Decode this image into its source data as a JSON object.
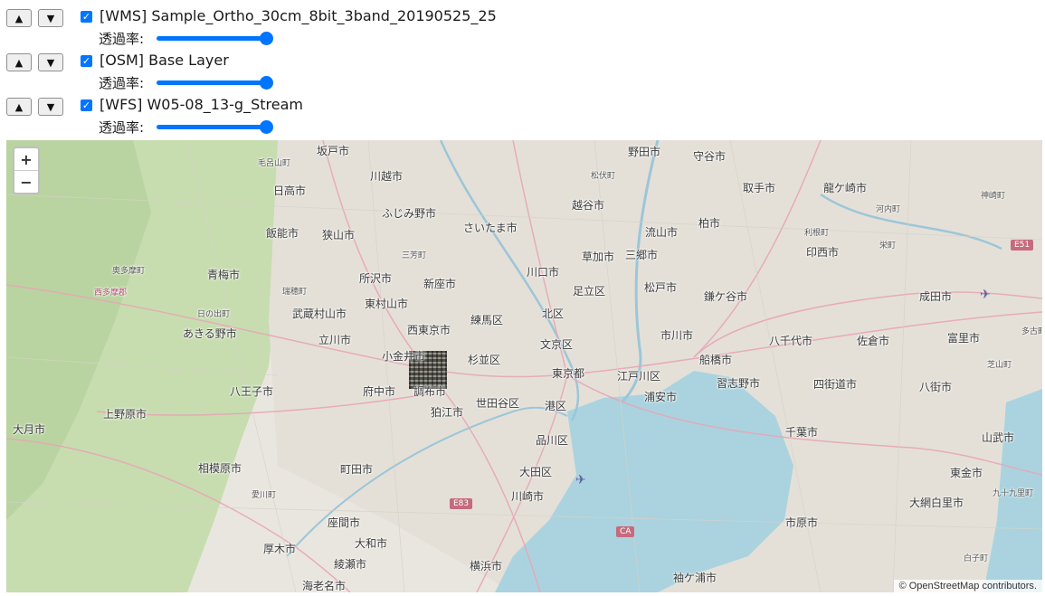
{
  "layers": [
    {
      "name": "[WMS] Sample_Ortho_30cm_8bit_3band_20190525_25",
      "opacity_label": "透過率:",
      "opacity": 1.0,
      "visible": true
    },
    {
      "name": "[OSM] Base Layer",
      "opacity_label": "透過率:",
      "opacity": 1.0,
      "visible": true
    },
    {
      "name": "[WFS] W05-08_13-g_Stream",
      "opacity_label": "透過率:",
      "opacity": 1.0,
      "visible": true
    }
  ],
  "controls": {
    "up": "▲",
    "down": "▼",
    "check": "✓"
  },
  "map": {
    "zoom_in": "+",
    "zoom_out": "−",
    "attribution": "© OpenStreetMap contributors.",
    "colors": {
      "land": "#e9e6df",
      "green": "#c7ddb0",
      "water": "#aad3df",
      "urban": "#e4e0d8"
    },
    "places": [
      {
        "t": "坂戸市"
      },
      {
        "t": "毛呂山町"
      },
      {
        "t": "川越市"
      },
      {
        "t": "野田市"
      },
      {
        "t": "守谷市"
      },
      {
        "t": "松伏町"
      },
      {
        "t": "日高市"
      },
      {
        "t": "取手市"
      },
      {
        "t": "龍ケ崎市"
      },
      {
        "t": "利根町"
      },
      {
        "t": "越谷市"
      },
      {
        "t": "ふじみ野市"
      },
      {
        "t": "さいたま市"
      },
      {
        "t": "流山市"
      },
      {
        "t": "柏市"
      },
      {
        "t": "飯能市"
      },
      {
        "t": "狭山市"
      },
      {
        "t": "三芳町"
      },
      {
        "t": "草加市"
      },
      {
        "t": "三郷市"
      },
      {
        "t": "印西市"
      },
      {
        "t": "栄町"
      },
      {
        "t": "河内町"
      },
      {
        "t": "神崎町"
      },
      {
        "t": "奥多摩町"
      },
      {
        "t": "青梅市"
      },
      {
        "t": "所沢市"
      },
      {
        "t": "川口市"
      },
      {
        "t": "西多摩郡"
      },
      {
        "t": "瑞穂町"
      },
      {
        "t": "新座市"
      },
      {
        "t": "足立区"
      },
      {
        "t": "松戸市"
      },
      {
        "t": "鎌ケ谷市"
      },
      {
        "t": "成田市"
      },
      {
        "t": "東村山市"
      },
      {
        "t": "日の出町"
      },
      {
        "t": "武蔵村山市"
      },
      {
        "t": "北区"
      },
      {
        "t": "練馬区"
      },
      {
        "t": "西東京市"
      },
      {
        "t": "あきる野市"
      },
      {
        "t": "立川市"
      },
      {
        "t": "文京区"
      },
      {
        "t": "市川市"
      },
      {
        "t": "八千代市"
      },
      {
        "t": "佐倉市"
      },
      {
        "t": "富里市"
      },
      {
        "t": "多古町"
      },
      {
        "t": "小金井市"
      },
      {
        "t": "杉並区"
      },
      {
        "t": "船橋市"
      },
      {
        "t": "芝山町"
      },
      {
        "t": "東京都"
      },
      {
        "t": "江戸川区"
      },
      {
        "t": "習志野市"
      },
      {
        "t": "四街道市"
      },
      {
        "t": "八街市"
      },
      {
        "t": "八王子市"
      },
      {
        "t": "府中市"
      },
      {
        "t": "調布市"
      },
      {
        "t": "世田谷区"
      },
      {
        "t": "港区"
      },
      {
        "t": "浦安市"
      },
      {
        "t": "上野原市"
      },
      {
        "t": "狛江市"
      },
      {
        "t": "千葉市"
      },
      {
        "t": "山武市"
      },
      {
        "t": "大月市"
      },
      {
        "t": "品川区"
      },
      {
        "t": "相模原市"
      },
      {
        "t": "町田市"
      },
      {
        "t": "大田区"
      },
      {
        "t": "東金市"
      },
      {
        "t": "愛川町"
      },
      {
        "t": "川崎市"
      },
      {
        "t": "九十九里町"
      },
      {
        "t": "大網白里市"
      },
      {
        "t": "座間市"
      },
      {
        "t": "市原市"
      },
      {
        "t": "厚木市"
      },
      {
        "t": "大和市"
      },
      {
        "t": "白子町"
      },
      {
        "t": "綾瀬市"
      },
      {
        "t": "横浜市"
      },
      {
        "t": "袖ケ浦市"
      },
      {
        "t": "海老名市"
      }
    ],
    "roads": [
      "E51",
      "E83",
      "CA"
    ]
  }
}
